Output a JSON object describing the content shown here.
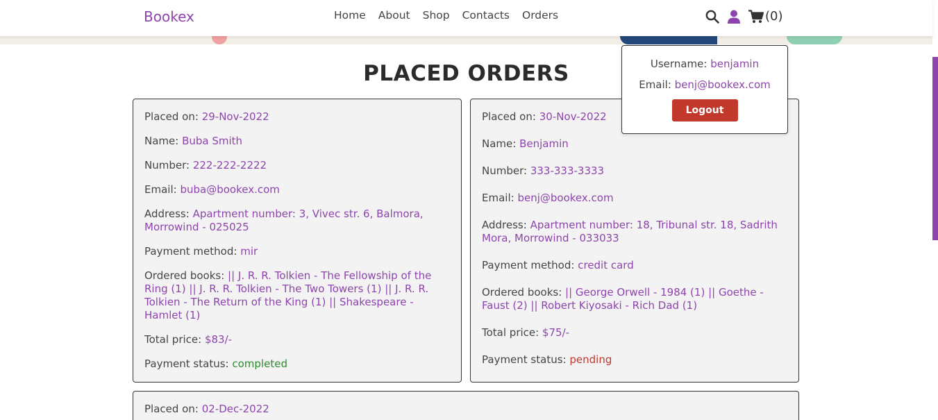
{
  "header": {
    "logo": "Bookex",
    "nav": [
      "Home",
      "About",
      "Shop",
      "Contacts",
      "Orders"
    ],
    "cart_count": "(0)"
  },
  "colors": {
    "accent": "#8e44ad",
    "danger": "#c0392b",
    "success": "#2e8b2e"
  },
  "icons": [
    "search-icon",
    "user-icon",
    "cart-icon"
  ],
  "page_title": "PLACED ORDERS",
  "profile": {
    "username_label": "Username:",
    "username": "benjamin",
    "email_label": "Email:",
    "email": "benj@bookex.com",
    "logout_label": "Logout"
  },
  "labels": {
    "placed_on": "Placed on:",
    "name": "Name:",
    "number": "Number:",
    "email": "Email:",
    "address": "Address:",
    "payment_method": "Payment method:",
    "ordered_books": "Ordered books:",
    "total_price": "Total price:",
    "payment_status": "Payment status:"
  },
  "orders": [
    {
      "placed_on": "29-Nov-2022",
      "name": "Buba Smith",
      "number": "222-222-2222",
      "email": "buba@bookex.com",
      "address": "Apartment number: 3, Vivec str. 6, Balmora, Morrowind - 025025",
      "payment_method": "mir",
      "ordered_books": "|| J. R. R. Tolkien - The Fellowship of the Ring (1) || J. R. R. Tolkien - The Two Towers (1) || J. R. R. Tolkien - The Return of the King (1) || Shakespeare - Hamlet (1)",
      "total_price": "$83/-",
      "payment_status": "completed"
    },
    {
      "placed_on": "30-Nov-2022",
      "name": "Benjamin",
      "number": "333-333-3333",
      "email": "benj@bookex.com",
      "address": "Apartment number: 18, Tribunal str. 18, Sadrith Mora, Morrowind - 033033",
      "payment_method": "credit card",
      "ordered_books": "|| George Orwell - 1984 (1) || Goethe - Faust (2) || Robert Kiyosaki - Rich Dad (1)",
      "total_price": "$75/-",
      "payment_status": "pending"
    },
    {
      "placed_on": "02-Dec-2022"
    }
  ]
}
